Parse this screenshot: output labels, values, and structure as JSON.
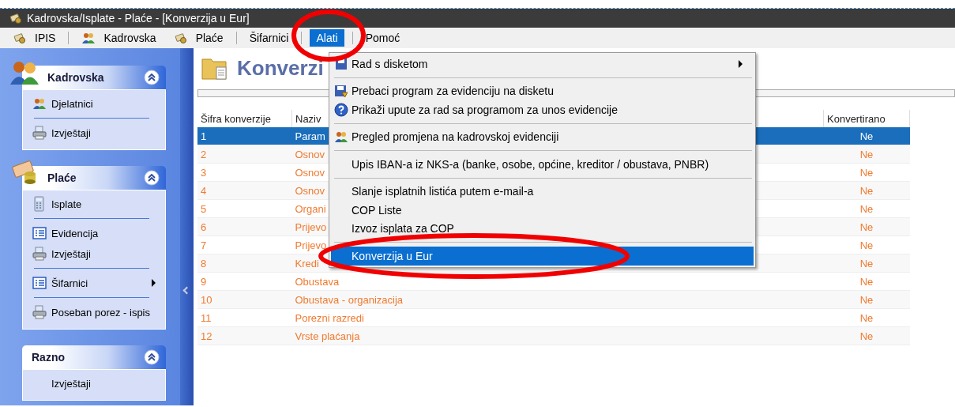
{
  "window": {
    "title": "Kadrovska/Isplate - Plaće - [Konverzija u Eur]"
  },
  "menubar": {
    "groups": [
      [
        {
          "label": "IPIS",
          "selected": false
        }
      ],
      [
        {
          "label": "Kadrovska",
          "selected": false
        },
        {
          "label": "Plaće",
          "selected": false
        }
      ],
      [
        {
          "label": "Šifarnici",
          "selected": false
        }
      ],
      [
        {
          "label": "Alati",
          "selected": true
        }
      ],
      [
        {
          "label": "Pomoć",
          "selected": false
        }
      ]
    ]
  },
  "sidebar": {
    "groups": [
      {
        "title": "Kadrovska",
        "sections": [
          [
            {
              "label": "Djelatnici",
              "submenu": false
            }
          ],
          [
            {
              "label": "Izvještaji",
              "submenu": false
            }
          ]
        ]
      },
      {
        "title": "Plaće",
        "sections": [
          [
            {
              "label": "Isplate",
              "submenu": false
            }
          ],
          [
            {
              "label": "Evidencija",
              "submenu": false
            },
            {
              "label": "Izvještaji",
              "submenu": false
            }
          ],
          [
            {
              "label": "Šifarnici",
              "submenu": true
            }
          ],
          [
            {
              "label": "Poseban porez - ispis",
              "submenu": false
            }
          ]
        ]
      },
      {
        "title": "Razno",
        "sections": [
          [
            {
              "label": "Izvještaji",
              "submenu": false
            }
          ]
        ]
      }
    ]
  },
  "content": {
    "title": "Konverzi"
  },
  "table": {
    "columns": [
      "Šifra konverzije",
      "Naziv",
      "Konvertirano"
    ],
    "rows": [
      {
        "code": "1",
        "name": "Param",
        "converted": "Ne",
        "selected": true
      },
      {
        "code": "2",
        "name": "Osnov",
        "converted": "Ne",
        "selected": false
      },
      {
        "code": "3",
        "name": "Osnov",
        "converted": "Ne",
        "selected": false
      },
      {
        "code": "4",
        "name": "Osnov",
        "converted": "Ne",
        "selected": false
      },
      {
        "code": "5",
        "name": "Organi",
        "converted": "Ne",
        "selected": false
      },
      {
        "code": "6",
        "name": "Prijevo",
        "converted": "Ne",
        "selected": false
      },
      {
        "code": "7",
        "name": "Prijevo",
        "converted": "Ne",
        "selected": false
      },
      {
        "code": "8",
        "name": "Kredi",
        "converted": "Ne",
        "selected": false
      },
      {
        "code": "9",
        "name": "Obustava",
        "converted": "Ne",
        "selected": false
      },
      {
        "code": "10",
        "name": "Obustava - organizacija",
        "converted": "Ne",
        "selected": false
      },
      {
        "code": "11",
        "name": "Porezni razredi",
        "converted": "Ne",
        "selected": false
      },
      {
        "code": "12",
        "name": "Vrste plaćanja",
        "converted": "Ne",
        "selected": false
      }
    ]
  },
  "dropdown": {
    "groups": [
      [
        {
          "label": "Rad s disketom",
          "submenu": true,
          "selected": false
        }
      ],
      [
        {
          "label": "Prebaci program za evidenciju na disketu",
          "submenu": false,
          "selected": false
        },
        {
          "label": "Prikaži upute za rad sa programom za unos evidencije",
          "submenu": false,
          "selected": false
        }
      ],
      [
        {
          "label": "Pregled promjena na kadrovskoj evidenciji",
          "submenu": false,
          "selected": false
        }
      ],
      [
        {
          "label": "Upis IBAN-a iz NKS-a (banke, osobe, općine, kreditor / obustava, PNBR)",
          "submenu": false,
          "selected": false
        }
      ],
      [
        {
          "label": "Slanje isplatnih listića putem e-mail-a",
          "submenu": false,
          "selected": false
        },
        {
          "label": "COP Liste",
          "submenu": false,
          "selected": false
        },
        {
          "label": "Izvoz isplata za COP",
          "submenu": false,
          "selected": false
        }
      ],
      [
        {
          "label": "Konverzija u Eur",
          "submenu": false,
          "selected": true
        }
      ]
    ]
  }
}
